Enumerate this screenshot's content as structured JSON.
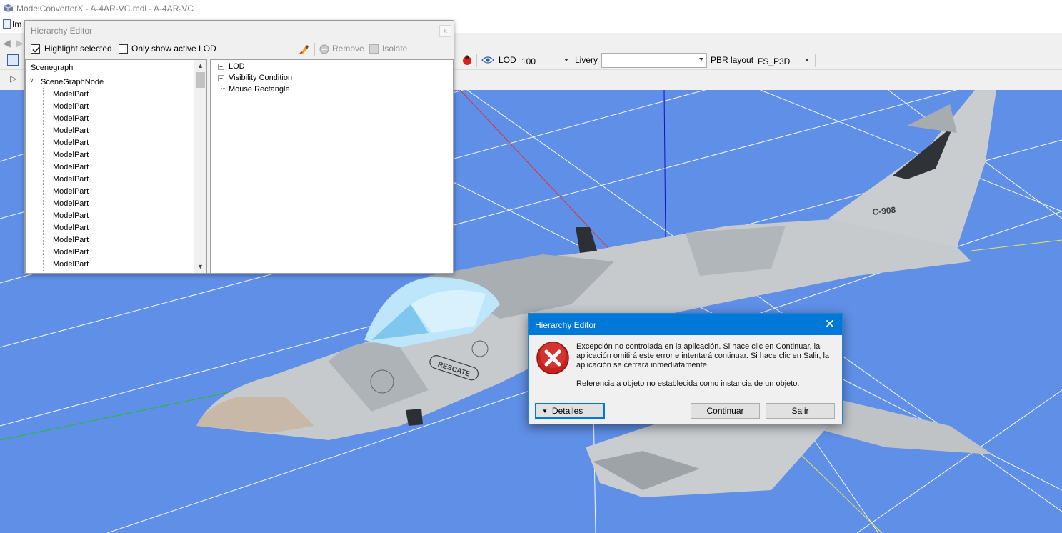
{
  "window": {
    "title": "ModelConverterX - A-4AR-VC.mdl - A-4AR-VC"
  },
  "menu": {
    "first_item": "Im"
  },
  "viewer_toolbar": {
    "lod_label": "LOD",
    "lod_value": "100",
    "livery_label": "Livery",
    "livery_value": "",
    "pbr_label": "PBR layout",
    "pbr_value": "FS_P3D"
  },
  "hierarchy_editor": {
    "title": "Hierarchy Editor",
    "close": "x",
    "highlight_selected": {
      "label": "Highlight selected",
      "checked": true
    },
    "only_active_lod": {
      "label": "Only show active LOD",
      "checked": false
    },
    "remove_label": "Remove",
    "isolate_label": "Isolate",
    "scenegraph": {
      "root": "Scenegraph",
      "node": "SceneGraphNode",
      "children": [
        "ModelPart",
        "ModelPart",
        "ModelPart",
        "ModelPart",
        "ModelPart",
        "ModelPart",
        "ModelPart",
        "ModelPart",
        "ModelPart",
        "ModelPart",
        "ModelPart",
        "ModelPart",
        "ModelPart",
        "ModelPart",
        "ModelPart"
      ]
    },
    "properties": [
      "LOD",
      "Visibility Condition",
      "Mouse Rectangle"
    ]
  },
  "aircraft": {
    "serial": "C-908",
    "badge": "RESCATE"
  },
  "error_dialog": {
    "title": "Hierarchy Editor",
    "message": "Excepción no controlada en la aplicación. Si hace clic en Continuar, la aplicación omitirá este error e intentará continuar. Si hace clic en Salir, la aplicación se cerrará inmediatamente.",
    "detail": "Referencia a objeto no establecida como instancia de un objeto.",
    "details_button": "Detalles",
    "continue_button": "Continuar",
    "exit_button": "Salir",
    "icon": "error-icon"
  },
  "colors": {
    "viewport_bg": "#5f8fe6",
    "dialog_title": "#0078d7",
    "error_red": "#d9302c"
  }
}
